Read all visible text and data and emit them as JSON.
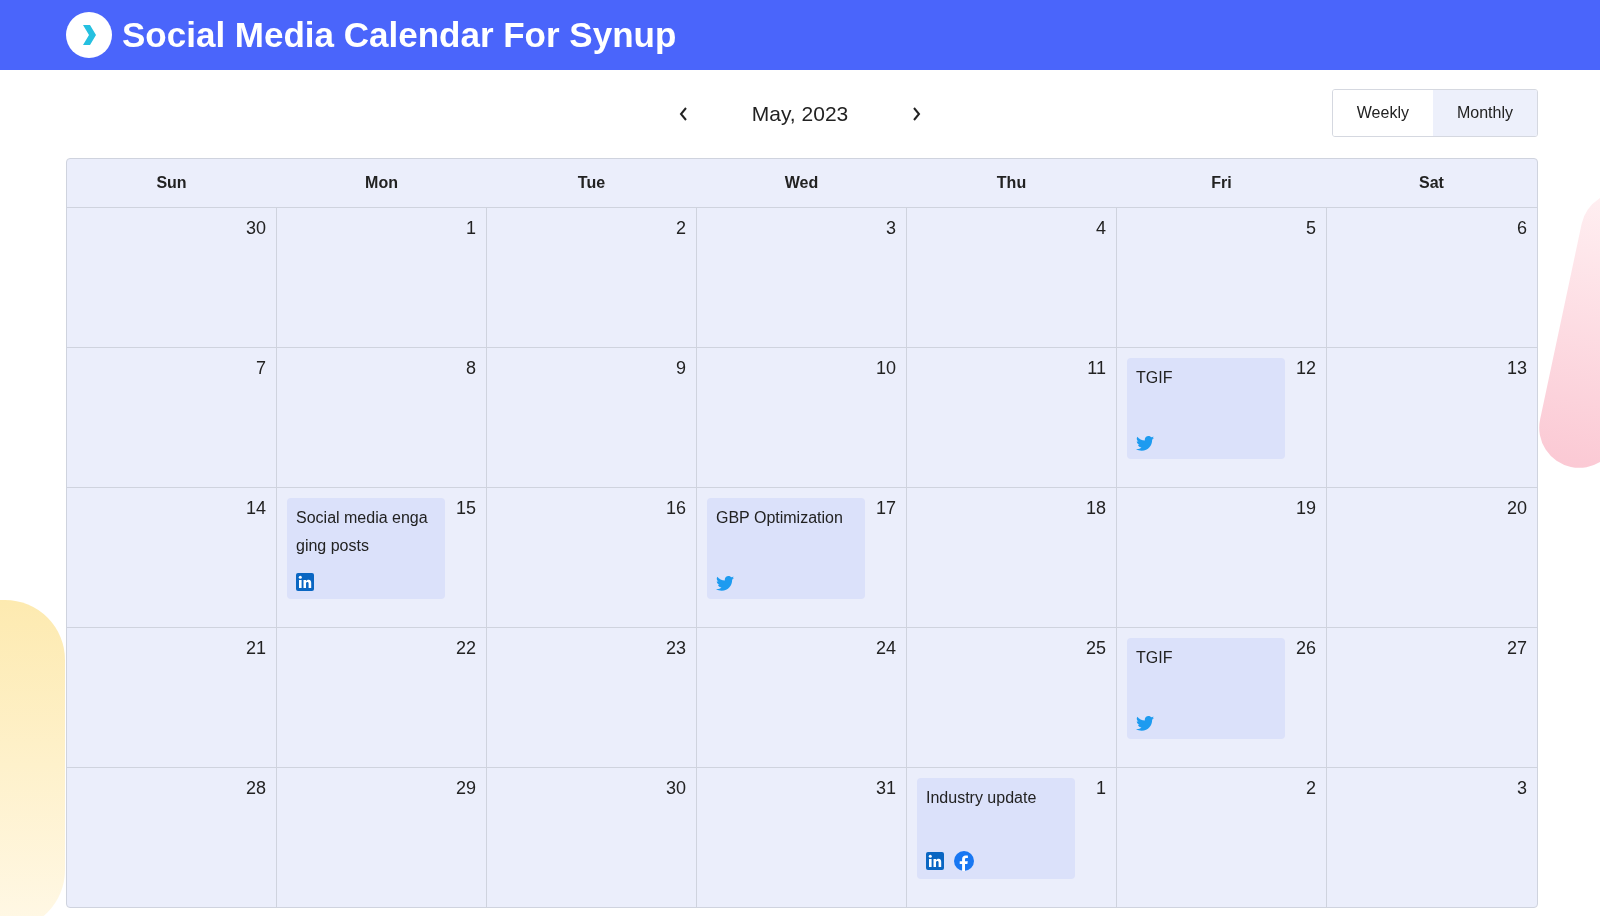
{
  "header": {
    "title": "Social Media Calendar For Synup"
  },
  "nav": {
    "month": "May, 2023"
  },
  "views": [
    {
      "label": "Weekly",
      "selected": false
    },
    {
      "label": "Monthly",
      "selected": true
    }
  ],
  "weekdays": [
    "Sun",
    "Mon",
    "Tue",
    "Wed",
    "Thu",
    "Fri",
    "Sat"
  ],
  "weeks": [
    {
      "days": [
        {
          "date": "30"
        },
        {
          "date": "1"
        },
        {
          "date": "2"
        },
        {
          "date": "3"
        },
        {
          "date": "4"
        },
        {
          "date": "5"
        },
        {
          "date": "6"
        }
      ]
    },
    {
      "days": [
        {
          "date": "7"
        },
        {
          "date": "8"
        },
        {
          "date": "9"
        },
        {
          "date": "10"
        },
        {
          "date": "11"
        },
        {
          "date": "12",
          "events": [
            {
              "title": "TGIF",
              "platforms": [
                {
                  "kind": "twitter"
                }
              ]
            }
          ]
        },
        {
          "date": "13"
        }
      ]
    },
    {
      "days": [
        {
          "date": "14"
        },
        {
          "date": "15",
          "events": [
            {
              "title": "Social media engaging posts",
              "platforms": [
                {
                  "kind": "linkedin"
                }
              ]
            }
          ]
        },
        {
          "date": "16"
        },
        {
          "date": "17",
          "events": [
            {
              "title": "GBP Optimization",
              "platforms": [
                {
                  "kind": "twitter"
                }
              ]
            }
          ]
        },
        {
          "date": "18"
        },
        {
          "date": "19"
        },
        {
          "date": "20"
        }
      ]
    },
    {
      "days": [
        {
          "date": "21"
        },
        {
          "date": "22"
        },
        {
          "date": "23"
        },
        {
          "date": "24"
        },
        {
          "date": "25"
        },
        {
          "date": "26",
          "events": [
            {
              "title": "TGIF",
              "platforms": [
                {
                  "kind": "twitter"
                }
              ]
            }
          ]
        },
        {
          "date": "27"
        }
      ]
    },
    {
      "days": [
        {
          "date": "28"
        },
        {
          "date": "29"
        },
        {
          "date": "30"
        },
        {
          "date": "31"
        },
        {
          "date": "1",
          "events": [
            {
              "title": "Industry update",
              "platforms": [
                {
                  "kind": "linkedin"
                },
                {
                  "kind": "facebook"
                }
              ]
            }
          ]
        },
        {
          "date": "2"
        },
        {
          "date": "3"
        }
      ]
    }
  ]
}
